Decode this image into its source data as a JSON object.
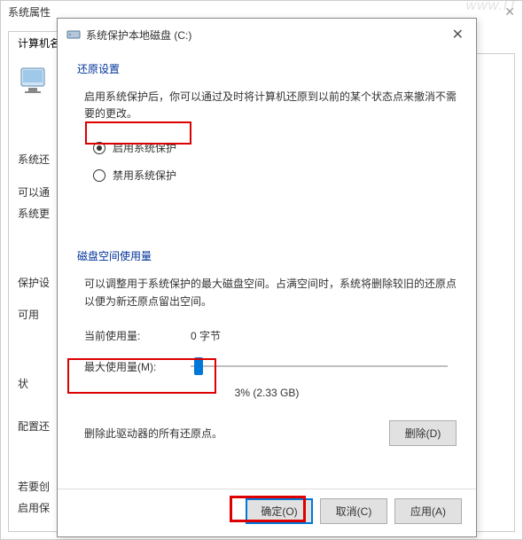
{
  "watermark": "www.IT",
  "parent": {
    "title": "系统属性",
    "tab": "计算机名",
    "sectionLabel": "系统还",
    "line1": "可以通",
    "line2": "系统更",
    "protect": "保护设",
    "col1": "可用",
    "col2": "状",
    "configLine": "配置还",
    "enableLine1": "若要创",
    "enableLine2": "启用保"
  },
  "dialog": {
    "title": "系统保护本地磁盘 (C:)",
    "restore": {
      "heading": "还原设置",
      "desc": "启用系统保护后，你可以通过及时将计算机还原到以前的某个状态点来撤消不需要的更改。",
      "enable": "启用系统保护",
      "disable": "禁用系统保护"
    },
    "disk": {
      "heading": "磁盘空间使用量",
      "desc": "可以调整用于系统保护的最大磁盘空间。占满空间时，系统将删除较旧的还原点以便为新还原点留出空间。",
      "currentLabel": "当前使用量:",
      "currentValue": "0 字节",
      "maxLabel": "最大使用量(M):",
      "percent": "3% (2.33 GB)"
    },
    "delete": {
      "text": "删除此驱动器的所有还原点。",
      "button": "删除(D)"
    },
    "buttons": {
      "ok": "确定(O)",
      "cancel": "取消(C)",
      "apply": "应用(A)"
    }
  }
}
